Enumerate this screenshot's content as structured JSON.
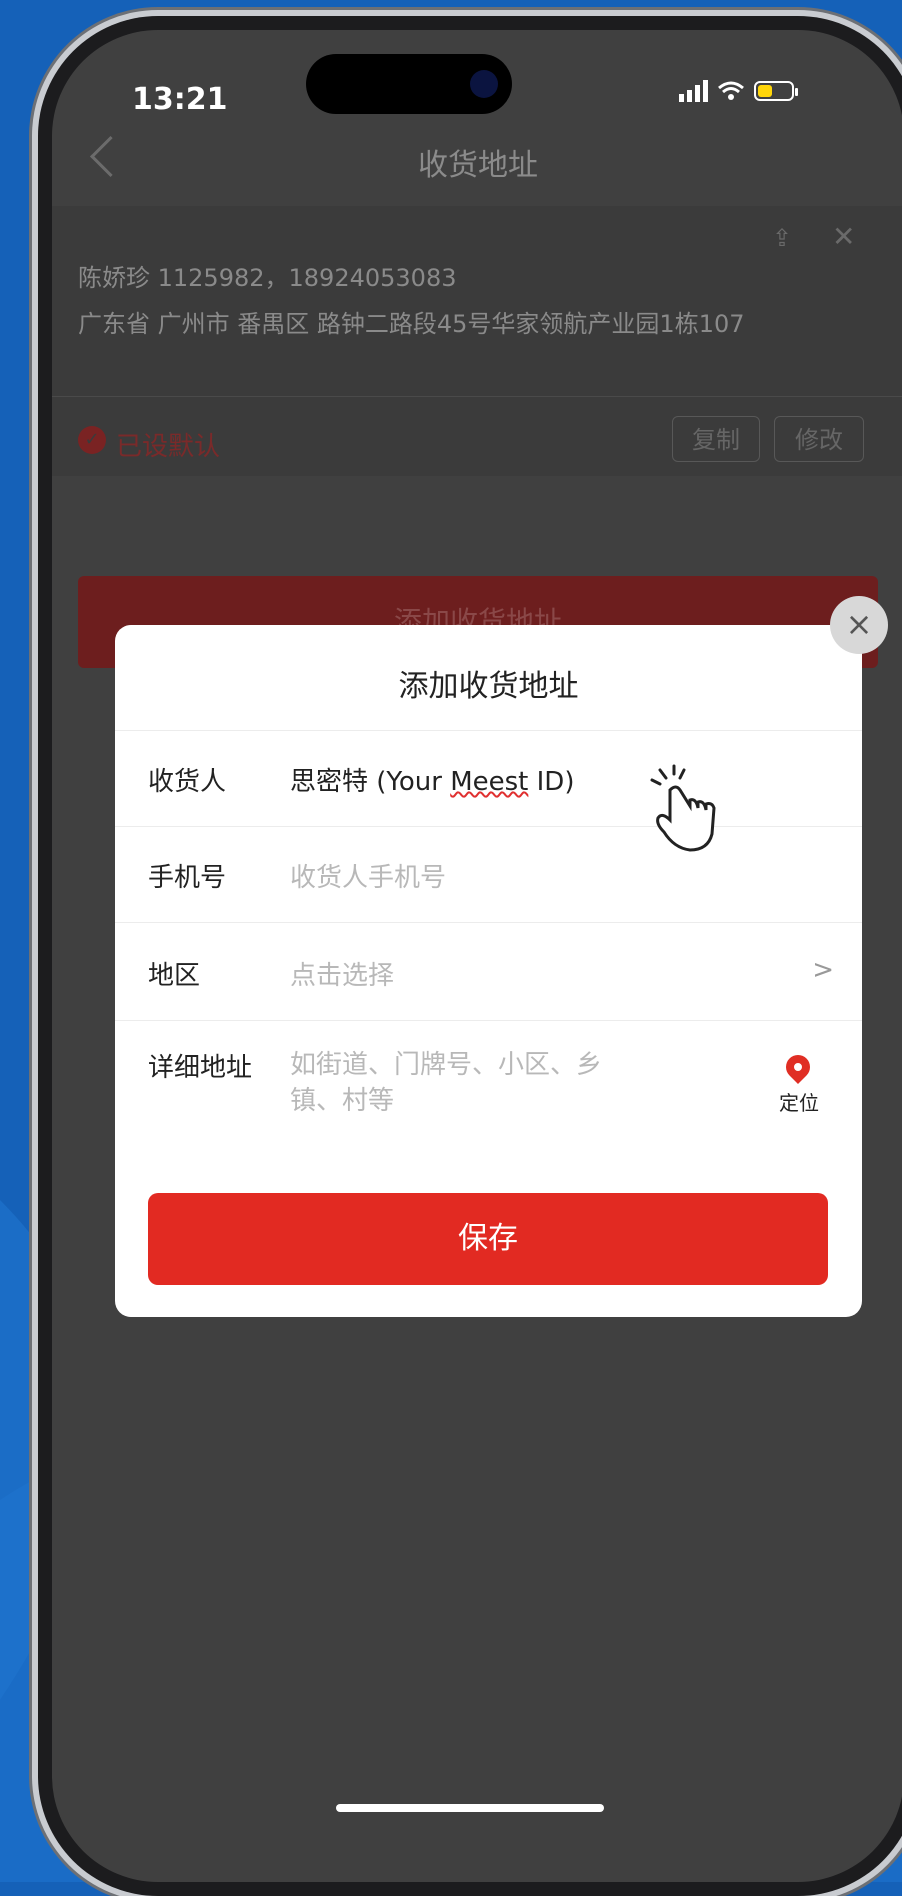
{
  "status_bar": {
    "time": "13:21"
  },
  "nav": {
    "title": "收货地址"
  },
  "address_card": {
    "line1": "陈娇珍 1125982，18924053083",
    "line2": "广东省 广州市 番禺区 路钟二路段45号华家领航产业园1栋107",
    "default_label": "已设默认",
    "copy_label": "复制",
    "edit_label": "修改"
  },
  "add_address_label": "添加收货地址",
  "modal": {
    "title": "添加收货地址",
    "rows": [
      {
        "label": "收货人",
        "value_prefix": "思密特 (Your ",
        "value_underlined": "Meest",
        "value_suffix": " ID)"
      },
      {
        "label": "手机号",
        "placeholder": "收货人手机号"
      },
      {
        "label": "地区",
        "placeholder": "点击选择",
        "chevron": ">"
      },
      {
        "label": "详细地址",
        "placeholder_line1": "如街道、门牌号、小区、乡",
        "placeholder_line2": "镇、村等",
        "locate_label": "定位"
      }
    ],
    "save_label": "保存",
    "close_glyph": "×"
  },
  "colors": {
    "accent": "#e22a22",
    "background": "#1561b8"
  }
}
